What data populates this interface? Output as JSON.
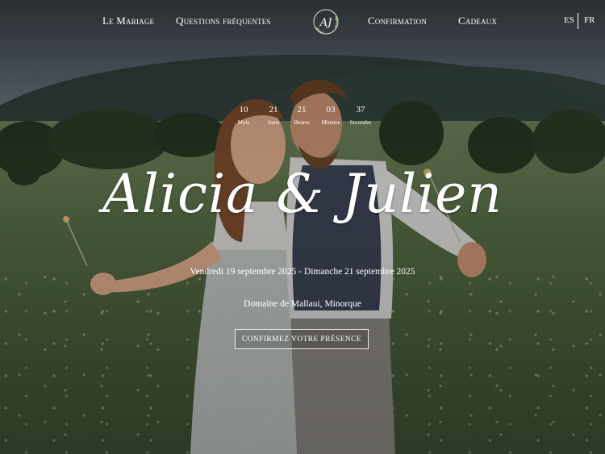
{
  "nav": {
    "left": [
      {
        "label": "Le Mariage"
      },
      {
        "label": "Questions fréquentes"
      }
    ],
    "right": [
      {
        "label": "Confirmation"
      },
      {
        "label": "Cadeaux"
      }
    ],
    "logo_monogram": "AJ",
    "languages": [
      "ES",
      "FR"
    ]
  },
  "countdown": [
    {
      "value": "10",
      "label": "Mois"
    },
    {
      "value": "21",
      "label": "Jours"
    },
    {
      "value": "21",
      "label": "Heures"
    },
    {
      "value": "03",
      "label": "Minutes"
    },
    {
      "value": "37",
      "label": "Secondes"
    }
  ],
  "hero": {
    "names": "Alicia & Julien",
    "dates": "Vendredi 19 septembre 2025 - Dimanche 21 septembre 2025",
    "venue": "Domaine de Mallaui, Minorque",
    "cta_label": "CONFIRMEZ VOTRE PRÉSENCE"
  },
  "colors": {
    "text": "#ffffff",
    "field": "#556b43",
    "sky": "#56606a"
  }
}
